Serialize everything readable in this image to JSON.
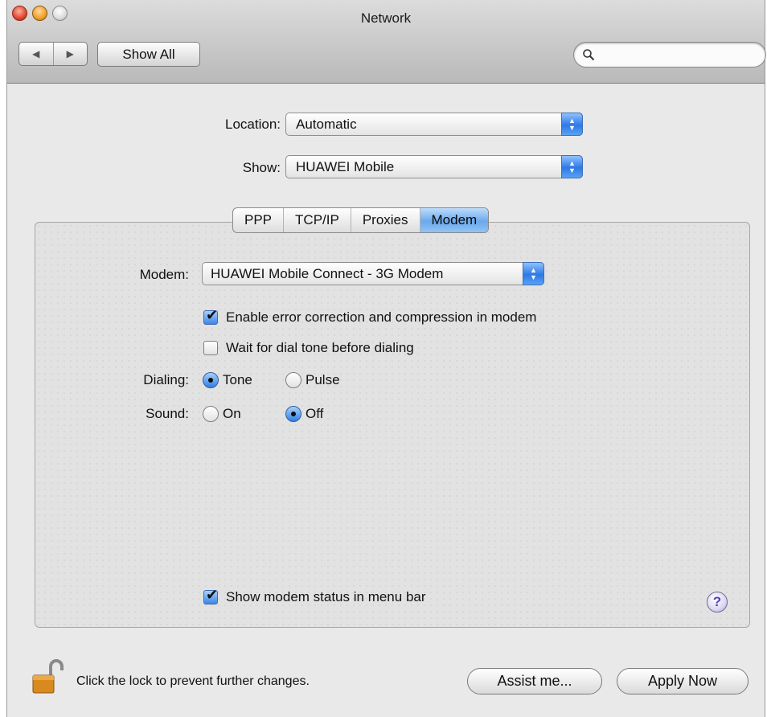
{
  "window": {
    "title": "Network"
  },
  "toolbar": {
    "back_glyph": "◀",
    "forward_glyph": "▶",
    "show_all_label": "Show All",
    "search_placeholder": "",
    "search_icon": "magnifier-icon"
  },
  "location": {
    "label": "Location:",
    "value": "Automatic"
  },
  "show": {
    "label": "Show:",
    "value": "HUAWEI Mobile"
  },
  "tabs": [
    {
      "label": "PPP",
      "selected": false
    },
    {
      "label": "TCP/IP",
      "selected": false
    },
    {
      "label": "Proxies",
      "selected": false
    },
    {
      "label": "Modem",
      "selected": true
    }
  ],
  "modem": {
    "label": "Modem:",
    "value": "HUAWEI Mobile Connect - 3G Modem",
    "error_correction": {
      "label": "Enable error correction and compression in modem",
      "checked": true
    },
    "wait_dial_tone": {
      "label": "Wait for dial tone before dialing",
      "checked": false
    },
    "dialing": {
      "label": "Dialing:",
      "options": [
        "Tone",
        "Pulse"
      ],
      "selected": "Tone"
    },
    "sound": {
      "label": "Sound:",
      "options": [
        "On",
        "Off"
      ],
      "selected": "Off"
    },
    "show_status": {
      "label": "Show modem status in menu bar",
      "checked": true
    }
  },
  "help": {
    "glyph": "?"
  },
  "footer": {
    "lock_text": "Click the lock to prevent further changes.",
    "assist_label": "Assist me...",
    "apply_label": "Apply Now"
  },
  "colors": {
    "accent": "#3c86e6",
    "window_bg": "#e9e9e9",
    "lock": "#d98a1e"
  }
}
